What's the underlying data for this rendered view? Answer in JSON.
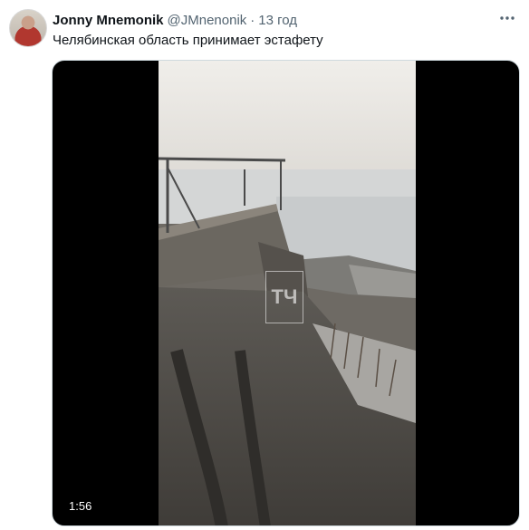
{
  "tweet": {
    "author_name": "Jonny Mnemonik",
    "handle": "@JMnenonik",
    "separator": "·",
    "time": "13 год",
    "text": "Челябинская область принимает эстафету",
    "more_icon": "more-dots-icon"
  },
  "media": {
    "duration": "1:56",
    "watermark": "ТЧ"
  }
}
